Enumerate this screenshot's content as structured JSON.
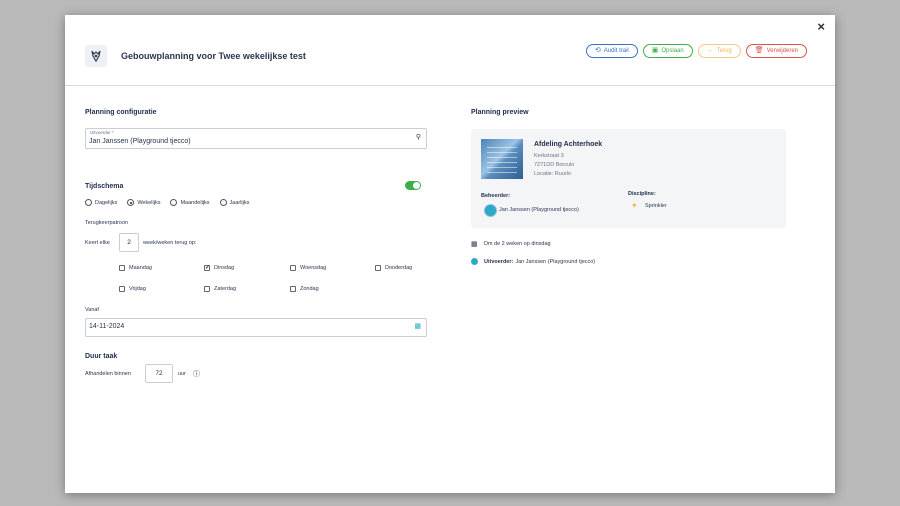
{
  "header": {
    "title": "Gebouwplanning voor Twee wekelijkse test",
    "close": "×",
    "actions": {
      "audit": "Audit trail",
      "save": "Opslaan",
      "back": "Terug",
      "delete": "Verwijderen"
    }
  },
  "config": {
    "section_title": "Planning configuratie",
    "uitvoerder": {
      "label": "Uitvoerder",
      "required": "*",
      "value": "Jan Janssen (Playground tjecco)"
    },
    "schedule_title": "Tijdschema",
    "toggle_on": true,
    "frequencies": [
      {
        "label": "Dagelijks",
        "selected": false
      },
      {
        "label": "Wekelijks",
        "selected": true
      },
      {
        "label": "Maandelijks",
        "selected": false
      },
      {
        "label": "Jaarlijks",
        "selected": false
      }
    ],
    "pattern_label": "Terugkeerpatroon",
    "repeat": {
      "prefix": "Keert elke",
      "value": "2",
      "suffix": "week/weken terug op:"
    },
    "days": [
      {
        "label": "Maandag",
        "checked": false
      },
      {
        "label": "Dinsdag",
        "checked": true
      },
      {
        "label": "Woensdag",
        "checked": false
      },
      {
        "label": "Donderdag",
        "checked": false
      },
      {
        "label": "Vrijdag",
        "checked": false
      },
      {
        "label": "Zaterdag",
        "checked": false
      },
      {
        "label": "Zondag",
        "checked": false
      }
    ],
    "vanaf": {
      "label": "Vanaf",
      "value": "14-11-2024"
    },
    "duration": {
      "title": "Duur taak",
      "prefix": "Afhandelen binnen",
      "value": "72",
      "unit": "uur"
    }
  },
  "preview": {
    "section_title": "Planning preview",
    "building": {
      "name": "Afdeling Achterhoek",
      "street": "Kerkstraat 3",
      "city": "7271DD Borculo",
      "location": "Locatie: Ruurlo"
    },
    "manager_label": "Beheerder:",
    "manager_value": "Jan Janssen (Playground tjecco)",
    "discipline_label": "Discipline:",
    "discipline_value": "Sprinkler",
    "schedule_text": "Om de 2 weken op dinsdag",
    "executor_label": "Uitvoerder:",
    "executor_value": "Jan Janssen (Playground tjecco)"
  }
}
